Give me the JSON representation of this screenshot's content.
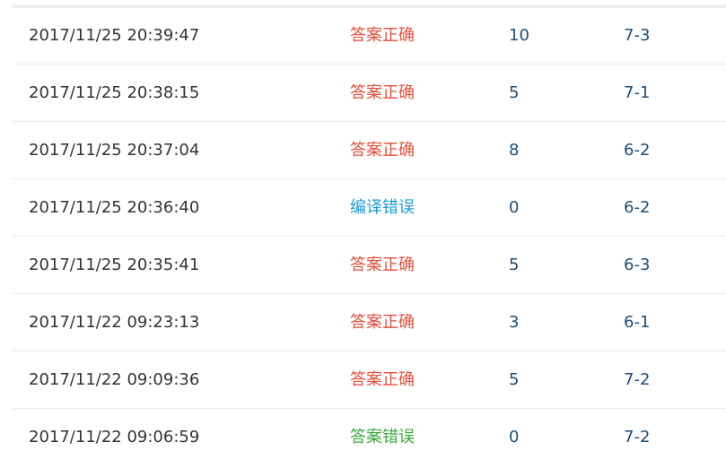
{
  "status_colors": {
    "答案正确": "#e0503c",
    "编译错误": "#1e9bd7",
    "答案错误": "#3ea83e"
  },
  "submissions": [
    {
      "time": "2017/11/25 20:39:47",
      "result": "答案正确",
      "score": "10",
      "problem": "7-3"
    },
    {
      "time": "2017/11/25 20:38:15",
      "result": "答案正确",
      "score": "5",
      "problem": "7-1"
    },
    {
      "time": "2017/11/25 20:37:04",
      "result": "答案正确",
      "score": "8",
      "problem": "6-2"
    },
    {
      "time": "2017/11/25 20:36:40",
      "result": "编译错误",
      "score": "0",
      "problem": "6-2"
    },
    {
      "time": "2017/11/25 20:35:41",
      "result": "答案正确",
      "score": "5",
      "problem": "6-3"
    },
    {
      "time": "2017/11/22 09:23:13",
      "result": "答案正确",
      "score": "3",
      "problem": "6-1"
    },
    {
      "time": "2017/11/22 09:09:36",
      "result": "答案正确",
      "score": "5",
      "problem": "7-2"
    },
    {
      "time": "2017/11/22 09:06:59",
      "result": "答案错误",
      "score": "0",
      "problem": "7-2"
    }
  ]
}
